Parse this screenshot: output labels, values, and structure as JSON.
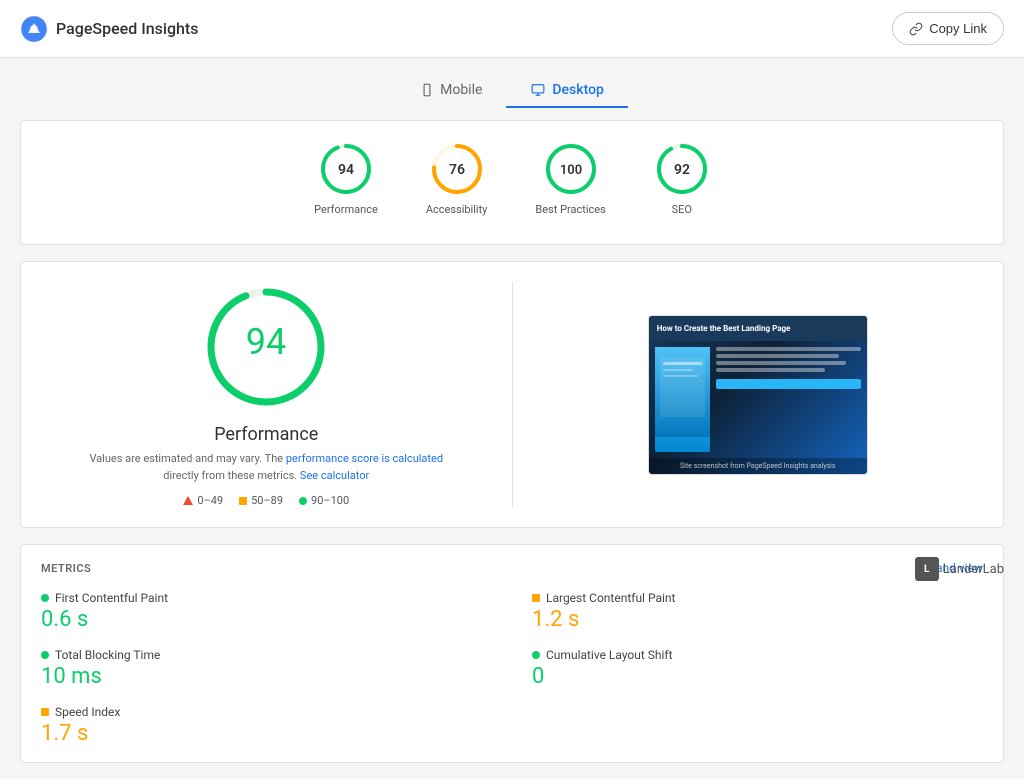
{
  "header": {
    "logo_text": "PageSpeed Insights",
    "copy_link_label": "Copy Link"
  },
  "tabs": [
    {
      "id": "mobile",
      "label": "Mobile",
      "active": false
    },
    {
      "id": "desktop",
      "label": "Desktop",
      "active": true
    }
  ],
  "scores": [
    {
      "id": "performance",
      "value": "94",
      "label": "Performance",
      "color": "#0cce6b",
      "stroke_color": "#0cce6b",
      "bg_color": "#e8f5e9"
    },
    {
      "id": "accessibility",
      "value": "76",
      "label": "Accessibility",
      "color": "#ffa400",
      "stroke_color": "#ffa400",
      "bg_color": "#fff8e1"
    },
    {
      "id": "best_practices",
      "value": "100",
      "label": "Best Practices",
      "color": "#0cce6b",
      "stroke_color": "#0cce6b",
      "bg_color": "#e8f5e9"
    },
    {
      "id": "seo",
      "value": "92",
      "label": "SEO",
      "color": "#0cce6b",
      "stroke_color": "#0cce6b",
      "bg_color": "#e8f5e9"
    }
  ],
  "performance_detail": {
    "big_score": "94",
    "title": "Performance",
    "desc_text": "Values are estimated and may vary. The",
    "desc_link1": "performance score is calculated",
    "desc_middle": "directly from these metrics.",
    "desc_link2": "See calculator",
    "legend": [
      {
        "type": "triangle",
        "color": "#f44336",
        "range": "0–49"
      },
      {
        "type": "square",
        "color": "#ffa400",
        "range": "50–89"
      },
      {
        "type": "dot",
        "color": "#0cce6b",
        "range": "90–100"
      }
    ]
  },
  "metrics": {
    "section_title": "METRICS",
    "expand_label": "Expand view",
    "items": [
      {
        "id": "fcp",
        "name": "First Contentful Paint",
        "value": "0.6 s",
        "status": "green",
        "col": 0
      },
      {
        "id": "lcp",
        "name": "Largest Contentful Paint",
        "value": "1.2 s",
        "status": "orange",
        "col": 1
      },
      {
        "id": "tbt",
        "name": "Total Blocking Time",
        "value": "10 ms",
        "status": "green",
        "col": 0
      },
      {
        "id": "cls",
        "name": "Cumulative Layout Shift",
        "value": "0",
        "status": "green",
        "col": 1
      },
      {
        "id": "si",
        "name": "Speed Index",
        "value": "1.7 s",
        "status": "orange",
        "col": 0
      }
    ]
  },
  "bottom_logo": {
    "icon_label": "L",
    "text": "LanderLab"
  }
}
